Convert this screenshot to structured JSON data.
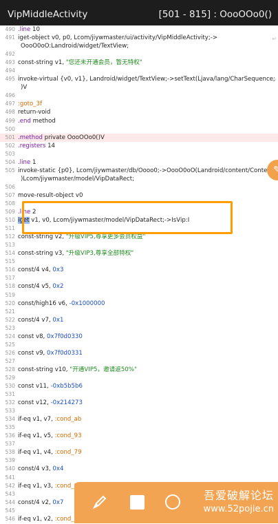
{
  "titlebar": {
    "title": "VipMiddleActivity",
    "range": "[501 - 815] : OooOOo0()"
  },
  "code_lines": [
    {
      "ln": "490",
      "text": ".line 10"
    },
    {
      "ln": "491",
      "text": "iget-object v0, p0, Lcom/jiywmaster/ui/activity/VipMiddleActivity;->"
    },
    {
      "ln": "",
      "text": "OooO0oO:Landroid/widget/TextView;",
      "cont": true
    },
    {
      "ln": "492",
      "text": ""
    },
    {
      "ln": "493",
      "text": "const-string v1, \"您还未开通会员，暂无特权\""
    },
    {
      "ln": "494",
      "text": ""
    },
    {
      "ln": "495",
      "text": "invoke-virtual {v0, v1}, Landroid/widget/TextView;->setText(Ljava/lang/CharSequence;"
    },
    {
      "ln": "",
      "text": ")V",
      "cont": true
    },
    {
      "ln": "496",
      "text": ""
    },
    {
      "ln": "497",
      "text": ":goto_3f"
    },
    {
      "ln": "498",
      "text": "return-void"
    },
    {
      "ln": "499",
      "text": ".end method"
    },
    {
      "ln": "500",
      "text": ""
    },
    {
      "ln": "501",
      "text": ".method private OooOOo0()V",
      "hl": true
    },
    {
      "ln": "502",
      "text": ".registers 14"
    },
    {
      "ln": "503",
      "text": ""
    },
    {
      "ln": "504",
      "text": ".line 1"
    },
    {
      "ln": "505",
      "text": "invoke-static {p0}, Lcom/jiywmaster/db/Oooo0;->OooO0oO(Landroid/content/Context;"
    },
    {
      "ln": "",
      "text": ")Lcom/jiywmaster/model/VipDataRect;",
      "cont": true
    },
    {
      "ln": "506",
      "text": ""
    },
    {
      "ln": "507",
      "text": "move-result-object v0"
    },
    {
      "ln": "508",
      "text": ""
    },
    {
      "ln": "509",
      "text": ".line 2"
    },
    {
      "ln": "510",
      "text": "iget v1, v0, Lcom/jiywmaster/model/VipDataRect;->IsVip:I"
    },
    {
      "ln": "511",
      "text": ""
    },
    {
      "ln": "512",
      "text": "const-string v2, \"升级VIP5,尊享更多会员权益\""
    },
    {
      "ln": "513",
      "text": ""
    },
    {
      "ln": "514",
      "text": "const-string v3, \"升级VIP3,尊享全部特权\""
    },
    {
      "ln": "515",
      "text": ""
    },
    {
      "ln": "516",
      "text": "const/4 v4, 0x3"
    },
    {
      "ln": "517",
      "text": ""
    },
    {
      "ln": "518",
      "text": "const/4 v5, 0x2"
    },
    {
      "ln": "519",
      "text": ""
    },
    {
      "ln": "520",
      "text": "const/high16 v6, -0x1000000"
    },
    {
      "ln": "521",
      "text": ""
    },
    {
      "ln": "522",
      "text": "const/4 v7, 0x1"
    },
    {
      "ln": "523",
      "text": ""
    },
    {
      "ln": "524",
      "text": "const v8, 0x7f0d0330"
    },
    {
      "ln": "525",
      "text": ""
    },
    {
      "ln": "526",
      "text": "const v9, 0x7f0d0331"
    },
    {
      "ln": "527",
      "text": ""
    },
    {
      "ln": "528",
      "text": "const-string v10, \"开通VIP5，邀请返50%\""
    },
    {
      "ln": "529",
      "text": ""
    },
    {
      "ln": "530",
      "text": "const v11, -0xb5b5b6"
    },
    {
      "ln": "531",
      "text": ""
    },
    {
      "ln": "532",
      "text": "const v12, -0x214273"
    },
    {
      "ln": "533",
      "text": ""
    },
    {
      "ln": "534",
      "text": "if-eq v1, v7, :cond_ab"
    },
    {
      "ln": "535",
      "text": ""
    },
    {
      "ln": "536",
      "text": "if-eq v1, v5, :cond_93"
    },
    {
      "ln": "537",
      "text": ""
    },
    {
      "ln": "538",
      "text": "if-eq v1, v4, :cond_79"
    },
    {
      "ln": "539",
      "text": ""
    },
    {
      "ln": "540",
      "text": "const/4 v3, 0x4"
    },
    {
      "ln": "541",
      "text": ""
    },
    {
      "ln": "542",
      "text": "if-eq v1, v3, :cond_61"
    },
    {
      "ln": "543",
      "text": ""
    },
    {
      "ln": "544",
      "text": "const/4 v2, 0x7"
    },
    {
      "ln": "545",
      "text": ""
    },
    {
      "ln": "546",
      "text": "if-eq v1, v2, :cond_44"
    }
  ],
  "toolbar": {
    "items": [
      "brush-icon",
      "square-icon",
      "circle-icon"
    ]
  },
  "watermark": {
    "line1": "吾爱破解论坛",
    "line2": "www.52pojie.cn"
  },
  "colors": {
    "accent": "#ff9d00",
    "titlebar": "#1d1d1d",
    "highlight_row": "#fde9e9"
  }
}
